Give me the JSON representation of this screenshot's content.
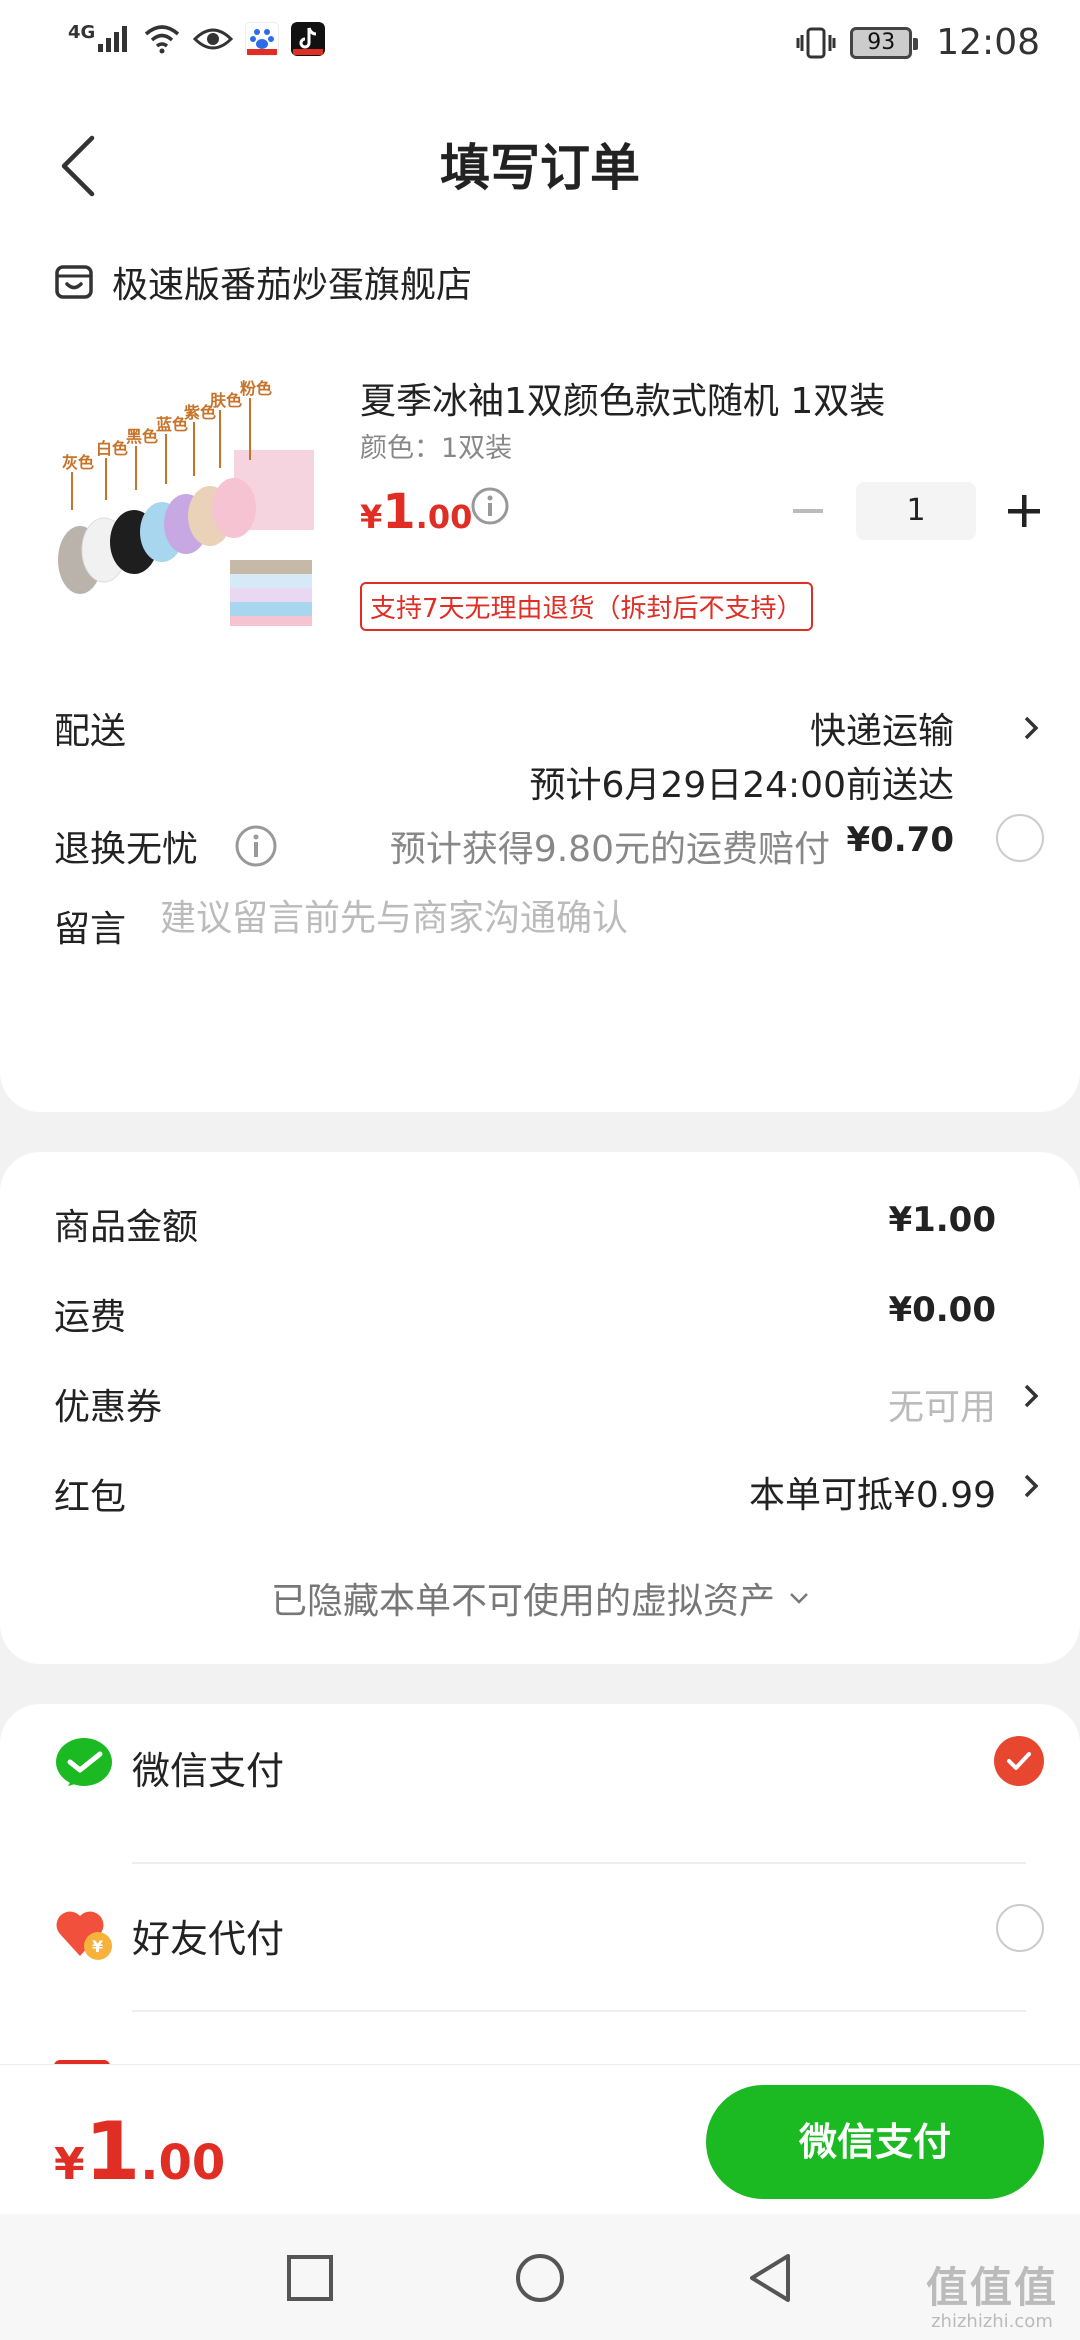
{
  "status_bar": {
    "network": "4G",
    "battery": "93",
    "time": "12:08"
  },
  "header": {
    "title": "填写订单"
  },
  "store": {
    "name": "极速版番茄炒蛋旗舰店"
  },
  "product": {
    "title": "夏季冰袖1双颜色款式随机 1双装",
    "spec": "颜色：1双装",
    "price_symbol": "¥",
    "price_int": "1",
    "price_dec": ".00",
    "quantity": "1",
    "return_tag": "支持7天无理由退货（拆封后不支持）",
    "image_labels": [
      "灰色",
      "白色",
      "黑色",
      "蓝色",
      "紫色",
      "肤色",
      "粉色"
    ]
  },
  "delivery": {
    "label": "配送",
    "method": "快递运输",
    "eta": "预计6月29日24:00前送达"
  },
  "return_worry": {
    "label": "退换无忧",
    "text": "预计获得9.80元的运费赔付",
    "amount": "¥0.70"
  },
  "message": {
    "label": "留言",
    "placeholder": "建议留言前先与商家沟通确认"
  },
  "summary": {
    "goods_label": "商品金额",
    "goods_value": "¥1.00",
    "shipping_label": "运费",
    "shipping_value": "¥0.00",
    "coupon_label": "优惠券",
    "coupon_value": "无可用",
    "redpacket_label": "红包",
    "redpacket_value": "本单可抵¥0.99",
    "hidden_assets": "已隐藏本单不可使用的虚拟资产"
  },
  "payment": {
    "methods": [
      {
        "label": "微信支付",
        "selected": true
      },
      {
        "label": "好友代付",
        "selected": false
      }
    ]
  },
  "bottom": {
    "total_symbol": "¥",
    "total_int": "1",
    "total_dec": ".00",
    "pay_button": "微信支付"
  },
  "watermark": {
    "logo": "值值值",
    "url": "zhizhizhi.com"
  },
  "colors": {
    "price_red": "#e02e24",
    "wechat_green": "#1bba22",
    "checked_orange": "#e8472f"
  }
}
